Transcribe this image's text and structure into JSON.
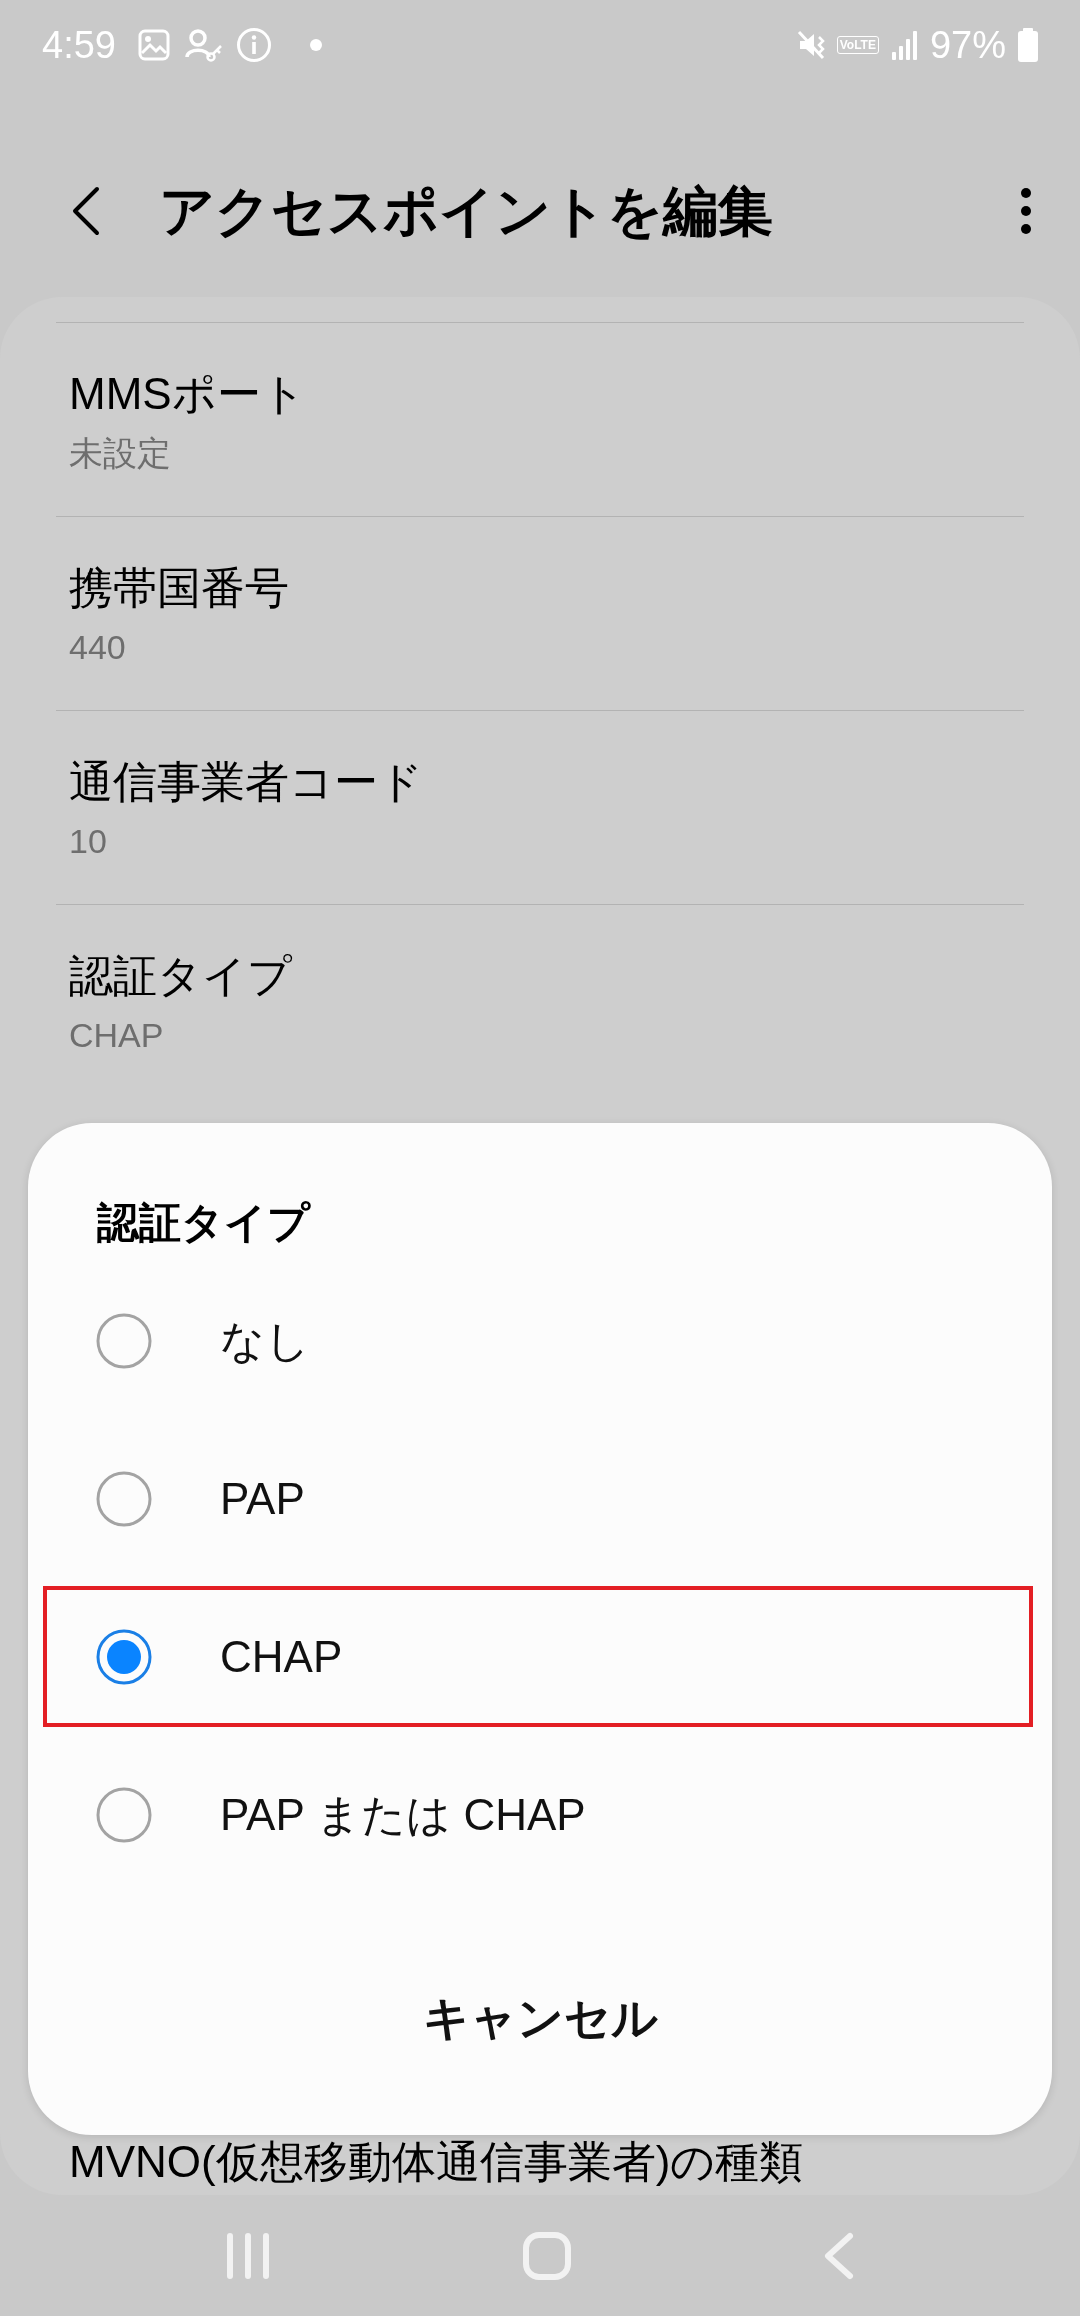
{
  "status_bar": {
    "time": "4:59",
    "volte": "VoLTE",
    "battery": "97%"
  },
  "header": {
    "title": "アクセスポイントを編集"
  },
  "settings": [
    {
      "title": "MMSポート",
      "value": "未設定"
    },
    {
      "title": "携帯国番号",
      "value": "440"
    },
    {
      "title": "通信事業者コード",
      "value": "10"
    },
    {
      "title": "認証タイプ",
      "value": "CHAP"
    },
    {
      "title": "MVNO(仮想移動体通信事業者)の種類"
    }
  ],
  "dialog": {
    "title": "認証タイプ",
    "options": [
      {
        "label": "なし",
        "selected": false,
        "highlighted": false
      },
      {
        "label": "PAP",
        "selected": false,
        "highlighted": false
      },
      {
        "label": "CHAP",
        "selected": true,
        "highlighted": true
      },
      {
        "label": "PAP または CHAP",
        "selected": false,
        "highlighted": false
      }
    ],
    "cancel": "キャンセル"
  }
}
